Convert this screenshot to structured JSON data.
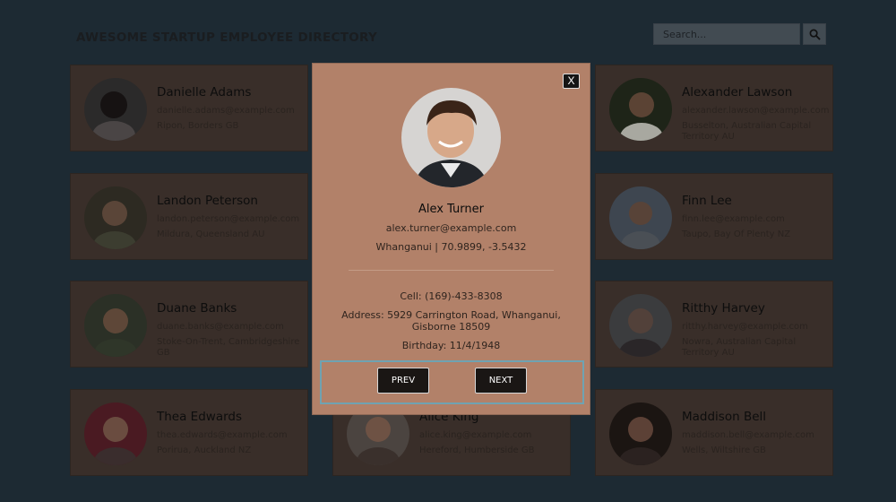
{
  "header": {
    "title": "AWESOME STARTUP EMPLOYEE DIRECTORY",
    "search_placeholder": "Search...",
    "search_icon": "search-icon"
  },
  "employees": [
    {
      "name": "Danielle Adams",
      "email": "danielle.adams@example.com",
      "location": "Ripon, Borders GB"
    },
    {
      "name": "Alexander Lawson",
      "email": "alexander.lawson@example.com",
      "location": "Busselton, Australian Capital Territory AU"
    },
    {
      "name": "Landon Peterson",
      "email": "landon.peterson@example.com",
      "location": "Mildura, Queensland AU"
    },
    {
      "name": "Finn Lee",
      "email": "finn.lee@example.com",
      "location": "Taupo, Bay Of Plenty NZ"
    },
    {
      "name": "Duane Banks",
      "email": "duane.banks@example.com",
      "location": "Stoke-On-Trent, Cambridgeshire GB"
    },
    {
      "name": "Ritthy Harvey",
      "email": "ritthy.harvey@example.com",
      "location": "Nowra, Australian Capital Territory AU"
    },
    {
      "name": "Thea Edwards",
      "email": "thea.edwards@example.com",
      "location": "Porirua, Auckland NZ"
    },
    {
      "name": "Alice King",
      "email": "alice.king@example.com",
      "location": "Hereford, Humberside GB"
    },
    {
      "name": "Maddison Bell",
      "email": "maddison.bell@example.com",
      "location": "Wells, Wiltshire GB"
    }
  ],
  "modal": {
    "close_label": "X",
    "name": "Alex Turner",
    "email": "alex.turner@example.com",
    "city_coords": "Whanganui | 70.9899, -3.5432",
    "cell": "Cell: (169)-433-8308",
    "address": "Address: 5929 Carrington Road, Whanganui, Gisborne 18509",
    "birthday": "Birthday: 11/4/1948",
    "prev_label": "PREV",
    "next_label": "NEXT"
  },
  "colors": {
    "background": "#1d2a33",
    "card": "#392e29",
    "modal": "#b28169",
    "nav_outline": "#6fa3b2"
  }
}
